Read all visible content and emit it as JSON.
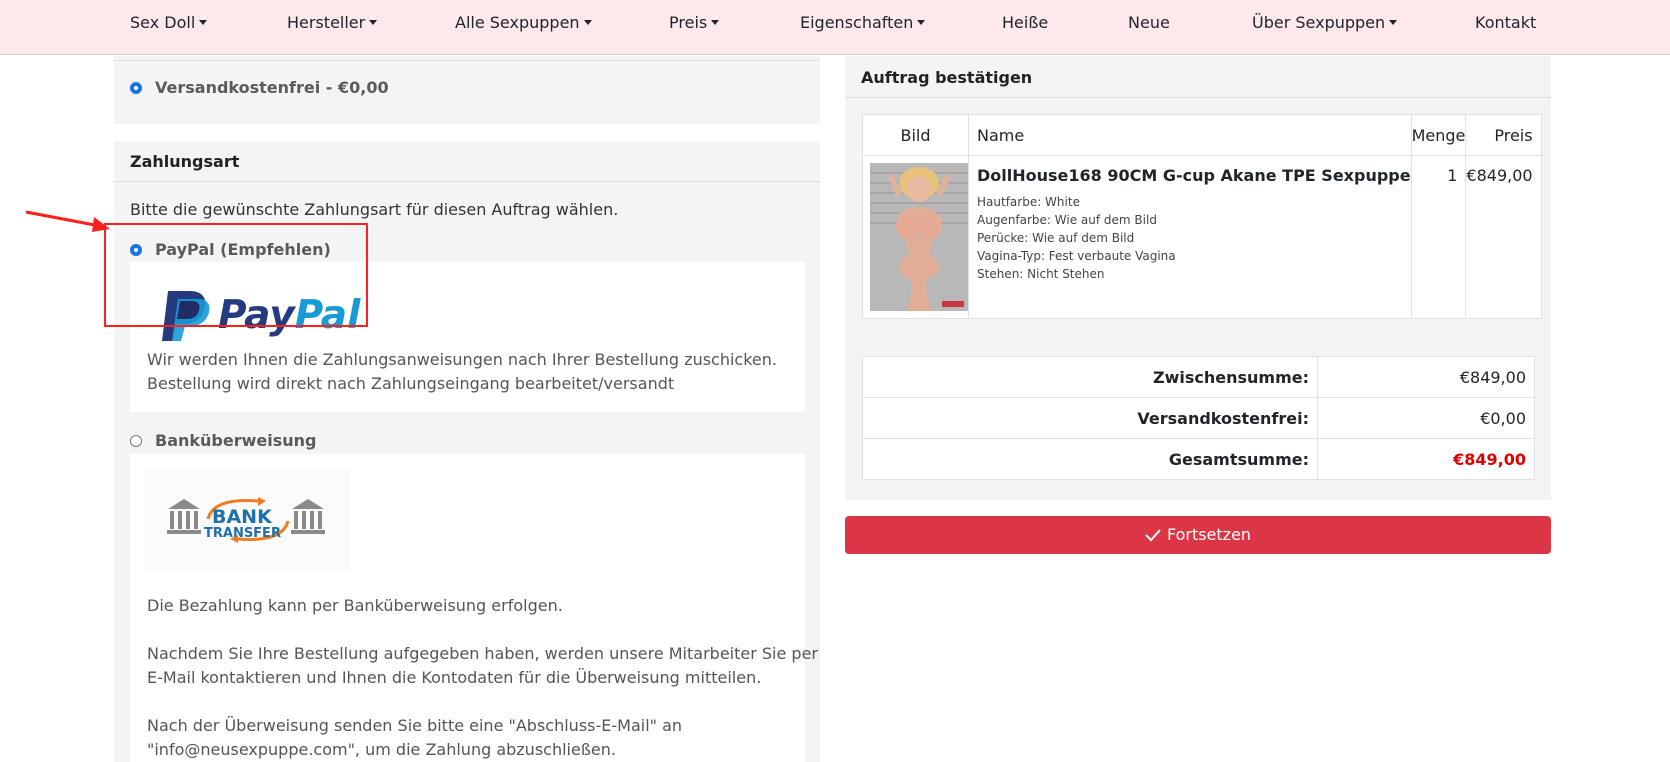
{
  "nav": {
    "items": [
      {
        "label": "Sex Doll",
        "dropdown": true
      },
      {
        "label": "Hersteller",
        "dropdown": true
      },
      {
        "label": "Alle Sexpuppen",
        "dropdown": true
      },
      {
        "label": "Preis",
        "dropdown": true
      },
      {
        "label": "Eigenschaften",
        "dropdown": true
      },
      {
        "label": "Heiße",
        "dropdown": false
      },
      {
        "label": "Neue",
        "dropdown": false
      },
      {
        "label": "Über Sexpuppen",
        "dropdown": true
      },
      {
        "label": "Kontakt",
        "dropdown": false
      }
    ]
  },
  "shipping": {
    "option_label": "Versandkostenfrei - €0,00",
    "selected": true
  },
  "payment": {
    "title": "Zahlungsart",
    "instruction": "Bitte die gewünschte Zahlungsart für diesen Auftrag wählen.",
    "paypal": {
      "label": "PayPal (Empfehlen)",
      "selected": true,
      "logo_text_1": "Pay",
      "logo_text_2": "Pal",
      "desc_line1": "Wir werden Ihnen die Zahlungsanweisungen nach Ihrer Bestellung zuschicken.",
      "desc_line2": "Bestellung wird direkt nach Zahlungseingang bearbeitet/versandt"
    },
    "bank": {
      "label": "Banküberweisung",
      "selected": false,
      "logo_text_1": "BANK",
      "logo_text_2": "TRANSFER",
      "desc1": "Die Bezahlung kann per Banküberweisung erfolgen.",
      "desc2_line1": "Nachdem Sie Ihre Bestellung aufgegeben haben, werden unsere Mitarbeiter Sie per",
      "desc2_line2": "E-Mail kontaktieren und Ihnen die Kontodaten für die Überweisung mitteilen.",
      "desc3_line1": "Nach der Überweisung senden Sie bitte eine \"Abschluss-E-Mail\" an",
      "desc3_line2": "\"info@neusexpuppe.com\", um die Zahlung abzuschließen."
    }
  },
  "order": {
    "title": "Auftrag bestätigen",
    "columns": {
      "image": "Bild",
      "name": "Name",
      "qty": "Menge",
      "price": "Preis"
    },
    "product": {
      "name": "DollHouse168 90CM G-cup Akane TPE Sexpuppe",
      "attributes": [
        "Hautfarbe: White",
        "Augenfarbe: Wie auf dem Bild",
        "Perücke: Wie auf dem Bild",
        "Vagina-Typ: Fest verbaute Vagina",
        "Stehen: Nicht Stehen"
      ],
      "qty": "1",
      "price": "€849,00"
    },
    "totals": {
      "subtotal_label": "Zwischensumme:",
      "subtotal": "€849,00",
      "shipping_label": "Versandkostenfrei:",
      "shipping": "€0,00",
      "total_label": "Gesamtsumme:",
      "total": "€849,00"
    },
    "continue_label": "Fortsetzen"
  },
  "colors": {
    "nav_bg": "#fde9ec",
    "accent_red": "#dc3545",
    "total_red": "#e00000",
    "radio_blue": "#1a73e8",
    "paypal_dark": "#253b80",
    "paypal_light": "#179bd7",
    "bank_blue": "#1f6fa8",
    "bank_orange": "#f07b21",
    "annotation_red": "#ff1f1f"
  }
}
